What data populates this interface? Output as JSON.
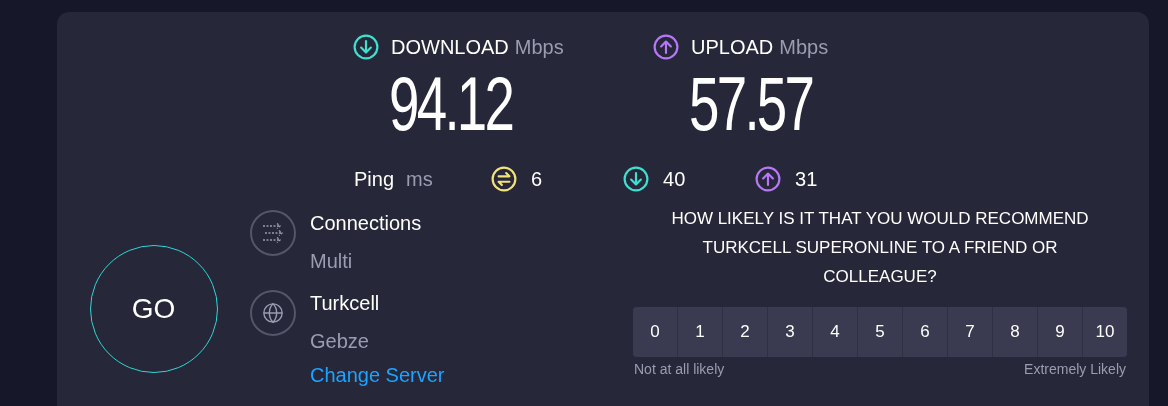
{
  "results": [
    {
      "kind": "download",
      "label": "DOWNLOAD",
      "unit": "Mbps",
      "value": "94.12"
    },
    {
      "kind": "upload",
      "label": "UPLOAD",
      "unit": "Mbps",
      "value": "57.57"
    }
  ],
  "ping": {
    "label": "Ping",
    "unit": "ms",
    "items": [
      {
        "kind": "idle",
        "value": "6"
      },
      {
        "kind": "download",
        "value": "40"
      },
      {
        "kind": "upload",
        "value": "31"
      }
    ]
  },
  "go_button": "GO",
  "connections": {
    "title": "Connections",
    "value": "Multi"
  },
  "server": {
    "title": "Turkcell",
    "value": "Gebze",
    "link": "Change Server"
  },
  "survey": {
    "question": "HOW LIKELY IS IT THAT YOU WOULD RECOMMEND TURKCELL SUPERONLINE TO A FRIEND OR COLLEAGUE?",
    "scores": [
      "0",
      "1",
      "2",
      "3",
      "4",
      "5",
      "6",
      "7",
      "8",
      "9",
      "10"
    ],
    "low_label": "Not at all likely",
    "high_label": "Extremely Likely"
  }
}
